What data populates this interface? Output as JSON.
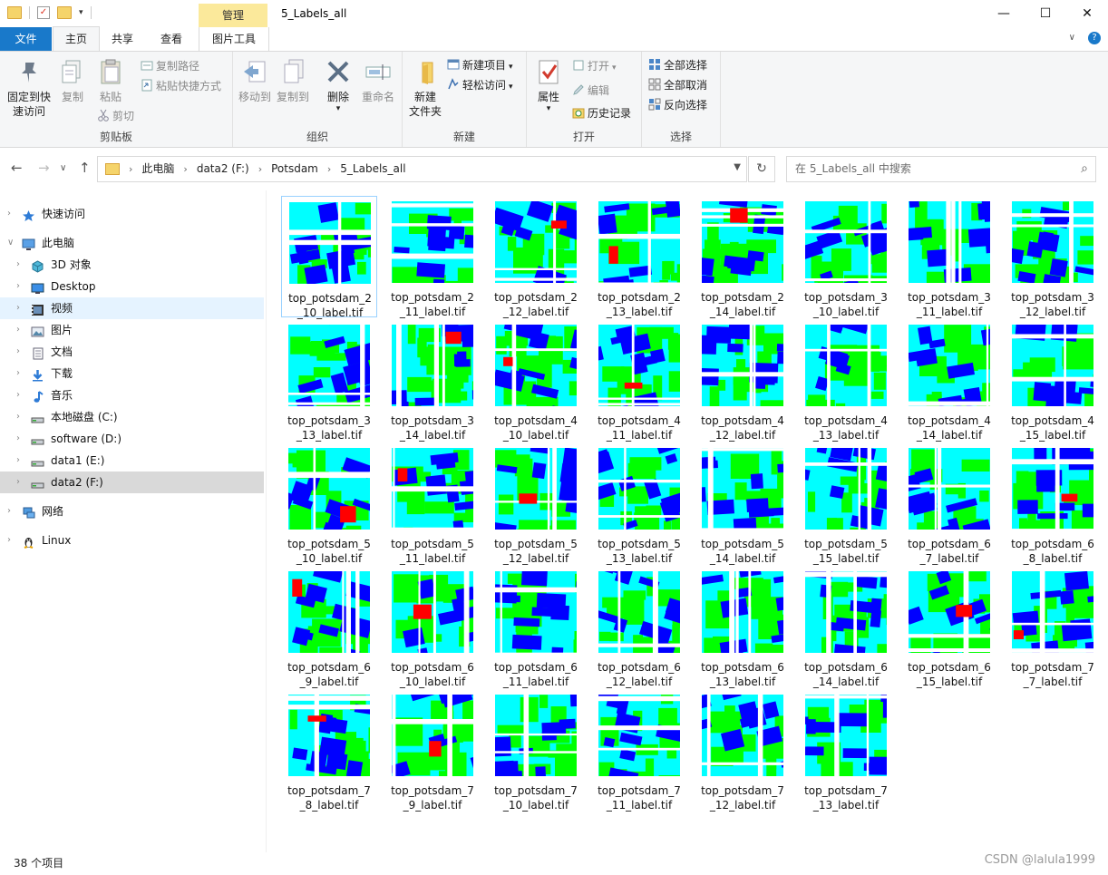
{
  "titlebar": {
    "manage_tab": "管理",
    "title": "5_Labels_all",
    "minimize": "—",
    "maximize": "☐",
    "close": "✕"
  },
  "tabs": {
    "file": "文件",
    "home": "主页",
    "share": "共享",
    "view": "查看",
    "picture_tools": "图片工具",
    "collapse": "∨",
    "help": "?"
  },
  "ribbon": {
    "clipboard": {
      "name": "剪贴板",
      "pin_line1": "固定到快",
      "pin_line2": "速访问",
      "copy": "复制",
      "paste": "粘贴",
      "copy_path": "复制路径",
      "paste_shortcut": "粘贴快捷方式",
      "cut": "剪切"
    },
    "organize": {
      "name": "组织",
      "move_to": "移动到",
      "copy_to": "复制到",
      "delete": "删除",
      "rename": "重命名"
    },
    "new": {
      "name": "新建",
      "new_folder_line1": "新建",
      "new_folder_line2": "文件夹",
      "new_item": "新建项目",
      "easy_access": "轻松访问"
    },
    "open": {
      "name": "打开",
      "properties": "属性",
      "open": "打开",
      "edit": "编辑",
      "history": "历史记录"
    },
    "select": {
      "name": "选择",
      "select_all": "全部选择",
      "select_none": "全部取消",
      "invert": "反向选择"
    }
  },
  "nav": {
    "back": "←",
    "forward": "→",
    "recent": "∨",
    "up": "↑",
    "crumbs": [
      "此电脑",
      "data2 (F:)",
      "Potsdam",
      "5_Labels_all"
    ],
    "refresh": "↻",
    "search_placeholder": "在 5_Labels_all 中搜索"
  },
  "sidebar": [
    {
      "label": "快速访问",
      "icon": "star-icon"
    },
    {
      "label": "此电脑",
      "icon": "computer-icon"
    },
    {
      "label": "3D 对象",
      "icon": "cube-icon"
    },
    {
      "label": "Desktop",
      "icon": "desktop-icon"
    },
    {
      "label": "视频",
      "icon": "video-icon"
    },
    {
      "label": "图片",
      "icon": "pictures-icon"
    },
    {
      "label": "文档",
      "icon": "document-icon"
    },
    {
      "label": "下载",
      "icon": "download-icon"
    },
    {
      "label": "音乐",
      "icon": "music-icon"
    },
    {
      "label": "本地磁盘 (C:)",
      "icon": "drive-icon"
    },
    {
      "label": "software (D:)",
      "icon": "drive-icon"
    },
    {
      "label": "data1 (E:)",
      "icon": "drive-icon"
    },
    {
      "label": "data2 (F:)",
      "icon": "drive-icon"
    },
    {
      "label": "网络",
      "icon": "network-icon"
    },
    {
      "label": "Linux",
      "icon": "linux-icon"
    }
  ],
  "files": [
    {
      "l1": "top_potsdam_2",
      "l2": "_10_label.tif"
    },
    {
      "l1": "top_potsdam_2",
      "l2": "_11_label.tif"
    },
    {
      "l1": "top_potsdam_2",
      "l2": "_12_label.tif"
    },
    {
      "l1": "top_potsdam_2",
      "l2": "_13_label.tif"
    },
    {
      "l1": "top_potsdam_2",
      "l2": "_14_label.tif"
    },
    {
      "l1": "top_potsdam_3",
      "l2": "_10_label.tif"
    },
    {
      "l1": "top_potsdam_3",
      "l2": "_11_label.tif"
    },
    {
      "l1": "top_potsdam_3",
      "l2": "_12_label.tif"
    },
    {
      "l1": "top_potsdam_3",
      "l2": "_13_label.tif"
    },
    {
      "l1": "top_potsdam_3",
      "l2": "_14_label.tif"
    },
    {
      "l1": "top_potsdam_4",
      "l2": "_10_label.tif"
    },
    {
      "l1": "top_potsdam_4",
      "l2": "_11_label.tif"
    },
    {
      "l1": "top_potsdam_4",
      "l2": "_12_label.tif"
    },
    {
      "l1": "top_potsdam_4",
      "l2": "_13_label.tif"
    },
    {
      "l1": "top_potsdam_4",
      "l2": "_14_label.tif"
    },
    {
      "l1": "top_potsdam_4",
      "l2": "_15_label.tif"
    },
    {
      "l1": "top_potsdam_5",
      "l2": "_10_label.tif"
    },
    {
      "l1": "top_potsdam_5",
      "l2": "_11_label.tif"
    },
    {
      "l1": "top_potsdam_5",
      "l2": "_12_label.tif"
    },
    {
      "l1": "top_potsdam_5",
      "l2": "_13_label.tif"
    },
    {
      "l1": "top_potsdam_5",
      "l2": "_14_label.tif"
    },
    {
      "l1": "top_potsdam_5",
      "l2": "_15_label.tif"
    },
    {
      "l1": "top_potsdam_6",
      "l2": "_7_label.tif"
    },
    {
      "l1": "top_potsdam_6",
      "l2": "_8_label.tif"
    },
    {
      "l1": "top_potsdam_6",
      "l2": "_9_label.tif"
    },
    {
      "l1": "top_potsdam_6",
      "l2": "_10_label.tif"
    },
    {
      "l1": "top_potsdam_6",
      "l2": "_11_label.tif"
    },
    {
      "l1": "top_potsdam_6",
      "l2": "_12_label.tif"
    },
    {
      "l1": "top_potsdam_6",
      "l2": "_13_label.tif"
    },
    {
      "l1": "top_potsdam_6",
      "l2": "_14_label.tif"
    },
    {
      "l1": "top_potsdam_6",
      "l2": "_15_label.tif"
    },
    {
      "l1": "top_potsdam_7",
      "l2": "_7_label.tif"
    },
    {
      "l1": "top_potsdam_7",
      "l2": "_8_label.tif"
    },
    {
      "l1": "top_potsdam_7",
      "l2": "_9_label.tif"
    },
    {
      "l1": "top_potsdam_7",
      "l2": "_10_label.tif"
    },
    {
      "l1": "top_potsdam_7",
      "l2": "_11_label.tif"
    },
    {
      "l1": "top_potsdam_7",
      "l2": "_12_label.tif"
    },
    {
      "l1": "top_potsdam_7",
      "l2": "_13_label.tif"
    }
  ],
  "status": {
    "count": "38 个项目"
  },
  "watermark": "CSDN @lalula1999",
  "colors": {
    "label_white": "#ffffff",
    "label_blue": "#0000ff",
    "label_cyan": "#00ffff",
    "label_green": "#00ff00",
    "label_red": "#ff0000",
    "label_yellow": "#ffff00",
    "accent": "#1979ca",
    "manage_tab_bg": "#fbe99b"
  }
}
